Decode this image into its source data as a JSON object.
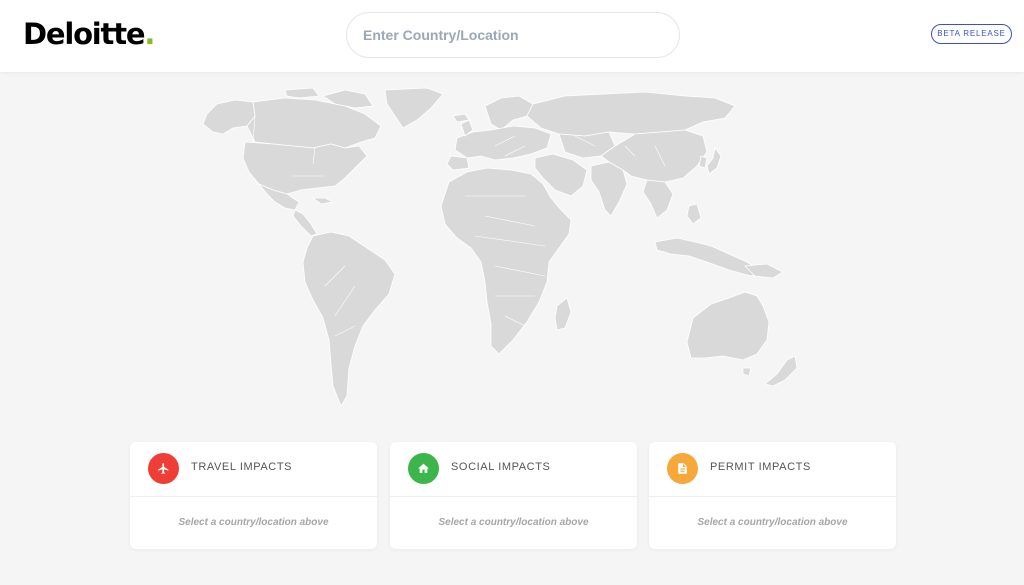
{
  "header": {
    "logo_text": "Deloitte",
    "logo_dot": ".",
    "search": {
      "placeholder": "Enter Country/Location",
      "value": ""
    },
    "beta_label": "BETA RELEASE"
  },
  "colors": {
    "brand_green": "#86bc25",
    "beta_blue": "#3b4fd6",
    "travel": "#ee3e36",
    "social": "#3cb54a",
    "permit": "#f6a83b",
    "map_land": "#d9d9d9"
  },
  "cards": [
    {
      "title": "TRAVEL IMPACTS",
      "icon": "airplane-icon",
      "message": "Select a country/location above"
    },
    {
      "title": "SOCIAL IMPACTS",
      "icon": "home-icon",
      "message": "Select a country/location above"
    },
    {
      "title": "PERMIT IMPACTS",
      "icon": "document-icon",
      "message": "Select a country/location above"
    }
  ]
}
